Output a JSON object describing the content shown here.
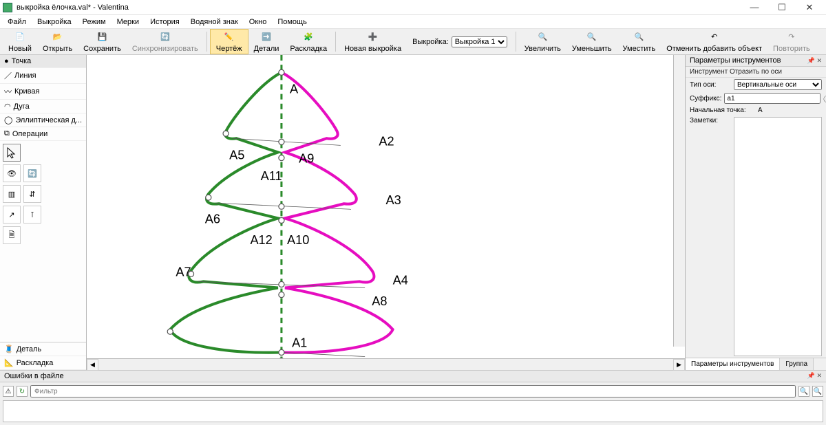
{
  "title": "выкройка ёлочка.val* - Valentina",
  "menus": [
    "Файл",
    "Выкройка",
    "Режим",
    "Мерки",
    "История",
    "Водяной знак",
    "Окно",
    "Помощь"
  ],
  "toolbar": {
    "new": "Новый",
    "open": "Открыть",
    "save": "Сохранить",
    "sync": "Синхронизировать",
    "drawing": "Чертёж",
    "details": "Детали",
    "layout": "Раскладка",
    "newPattern": "Новая выкройка",
    "patternLabel": "Выкройка:",
    "patternOptions": [
      "Выкройка 1"
    ],
    "zoomIn": "Увеличить",
    "zoomOut": "Уменьшить",
    "zoomFit": "Уместить",
    "undo": "Отменить добавить объект",
    "redo": "Повторить"
  },
  "leftCats": {
    "point": "Точка",
    "line": "Линия",
    "curve": "Кривая",
    "arc": "Дуга",
    "ellipse": "Эллиптическая д...",
    "ops": "Операции",
    "detail": "Деталь",
    "layout": "Раскладка"
  },
  "rp": {
    "title": "Параметры инструментов",
    "sub": "Инструмент Отразить по оси",
    "axisLabel": "Тип оси:",
    "axisOptions": [
      "Вертикальные оси"
    ],
    "suffixLabel": "Суффикс:",
    "suffixValue": "a1",
    "startPtLabel": "Начальная точка:",
    "startPtValue": "A",
    "notesLabel": "Заметки:",
    "tabParams": "Параметры инструментов",
    "tabGroup": "Группа"
  },
  "bottom": {
    "title": "Ошибки в файле",
    "filterPlaceholder": "Фильтр"
  },
  "points": {
    "A": "A",
    "A1": "A1",
    "A2": "A2",
    "A3": "A3",
    "A4": "A4",
    "A5": "A5",
    "A6": "A6",
    "A7": "A7",
    "A8": "A8",
    "A9": "A9",
    "A10": "A10",
    "A11": "A11",
    "A12": "A12"
  }
}
